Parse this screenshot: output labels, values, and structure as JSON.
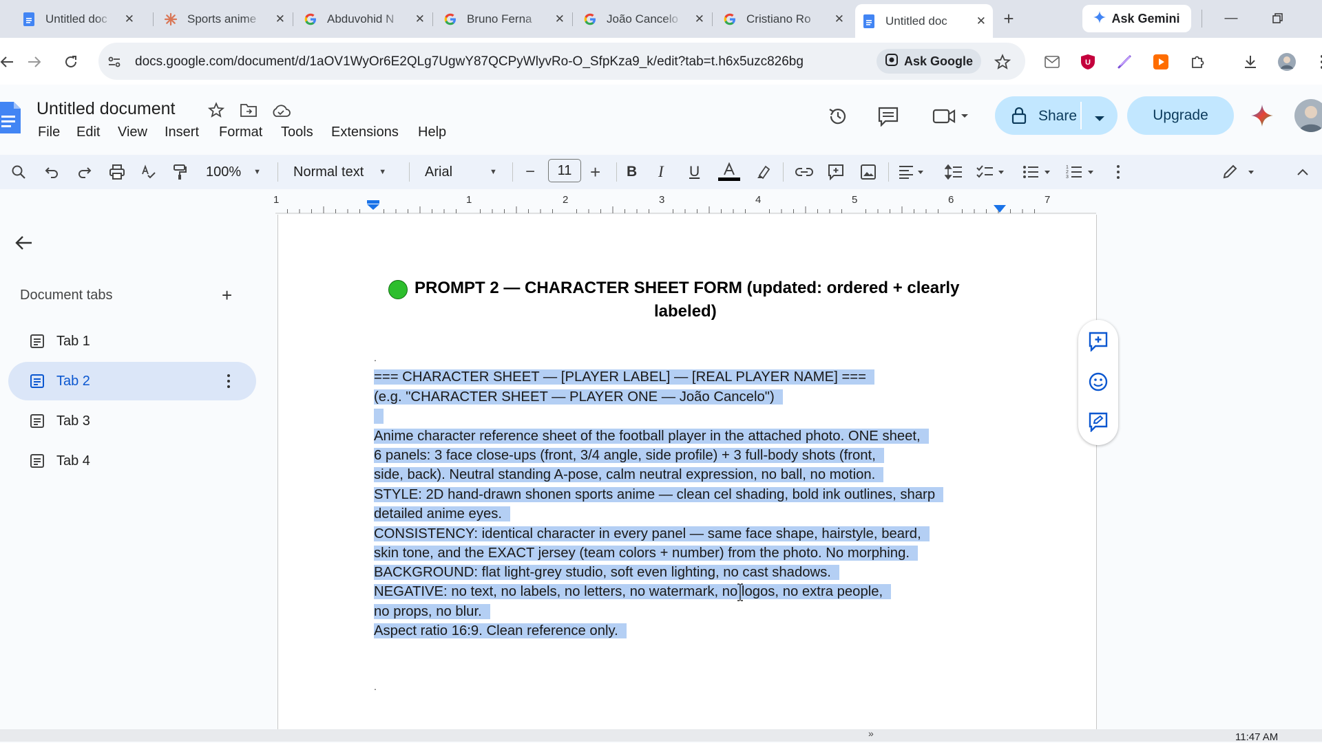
{
  "browser": {
    "tabs": [
      {
        "title": "Untitled document - Google Docs",
        "icon": "docs-icon",
        "active": false
      },
      {
        "title": "Sports anime",
        "icon": "claude-icon",
        "active": false
      },
      {
        "title": "Abduvohid N",
        "icon": "google-icon",
        "active": false
      },
      {
        "title": "Bruno Ferna",
        "icon": "google-icon",
        "active": false
      },
      {
        "title": "João Cancelo",
        "icon": "google-icon",
        "active": false
      },
      {
        "title": "Cristiano Ro",
        "icon": "google-icon",
        "active": false
      },
      {
        "title": "Untitled document - Google Docs",
        "icon": "docs-icon",
        "active": true
      }
    ],
    "tab_display": [
      "Untitled doc",
      "Sports anime",
      "Abduvohid N",
      "Bruno Ferna",
      "João Cancelo",
      "Cristiano Ro",
      "Untitled doc"
    ],
    "new_tab_symbol": "+",
    "gemini_label": "Ask Gemini",
    "url": "docs.google.com/document/d/1aOV1WyOr6E2QLg7UgwY87QCPyWlyvRo-O_SfpKza9_k/edit?tab=t.h6x5uzc826bg",
    "ask_google_label": "Ask Google"
  },
  "docs": {
    "title": "Untitled document",
    "menus": [
      "File",
      "Edit",
      "View",
      "Insert",
      "Format",
      "Tools",
      "Extensions",
      "Help"
    ],
    "share_label": "Share",
    "upgrade_label": "Upgrade",
    "toolbar": {
      "zoom": "100%",
      "style": "Normal text",
      "font": "Arial",
      "font_size": "11",
      "decrease": "−",
      "increase": "+"
    },
    "ruler_numbers": [
      "1",
      "1",
      "2",
      "3",
      "4",
      "5",
      "6",
      "7"
    ],
    "sidebar": {
      "heading": "Document tabs",
      "add_symbol": "+",
      "tabs": [
        "Tab 1",
        "Tab 2",
        "Tab 3",
        "Tab 4"
      ],
      "active_tab": "Tab 2"
    },
    "content": {
      "heading_line1": "PROMPT 2 — CHARACTER SHEET FORM (updated: ordered + clearly",
      "heading_line2": "labeled)",
      "lines": [
        "=== CHARACTER SHEET — [PLAYER LABEL] — [REAL PLAYER NAME] ===",
        "(e.g. \"CHARACTER SHEET — PLAYER ONE — João Cancelo\")",
        "",
        "Anime character reference sheet of the football player in the attached photo. ONE sheet,",
        "6 panels: 3 face close-ups (front, 3/4 angle, side profile) + 3 full-body shots (front,",
        "side, back). Neutral standing A-pose, calm neutral expression, no ball, no motion.",
        "STYLE: 2D hand-drawn shonen sports anime — clean cel shading, bold ink outlines, sharp",
        "detailed anime eyes.",
        "CONSISTENCY: identical character in every panel — same face shape, hairstyle, beard,",
        "skin tone, and the EXACT jersey (team colors + number) from the photo. No morphing.",
        "BACKGROUND: flat light-grey studio, soft even lighting, no cast shadows.",
        "NEGATIVE: no text, no labels, no letters, no watermark, no logos, no extra people,",
        "no props, no blur.",
        "Aspect ratio 16:9. Clean reference only."
      ]
    }
  },
  "taskbar": {
    "clock": "11:47 AM"
  },
  "colors": {
    "accent": "#0b57d0",
    "share_bg": "#c2e7ff",
    "selection": "#b4cff4",
    "status_dot": "#2dbe2d"
  }
}
